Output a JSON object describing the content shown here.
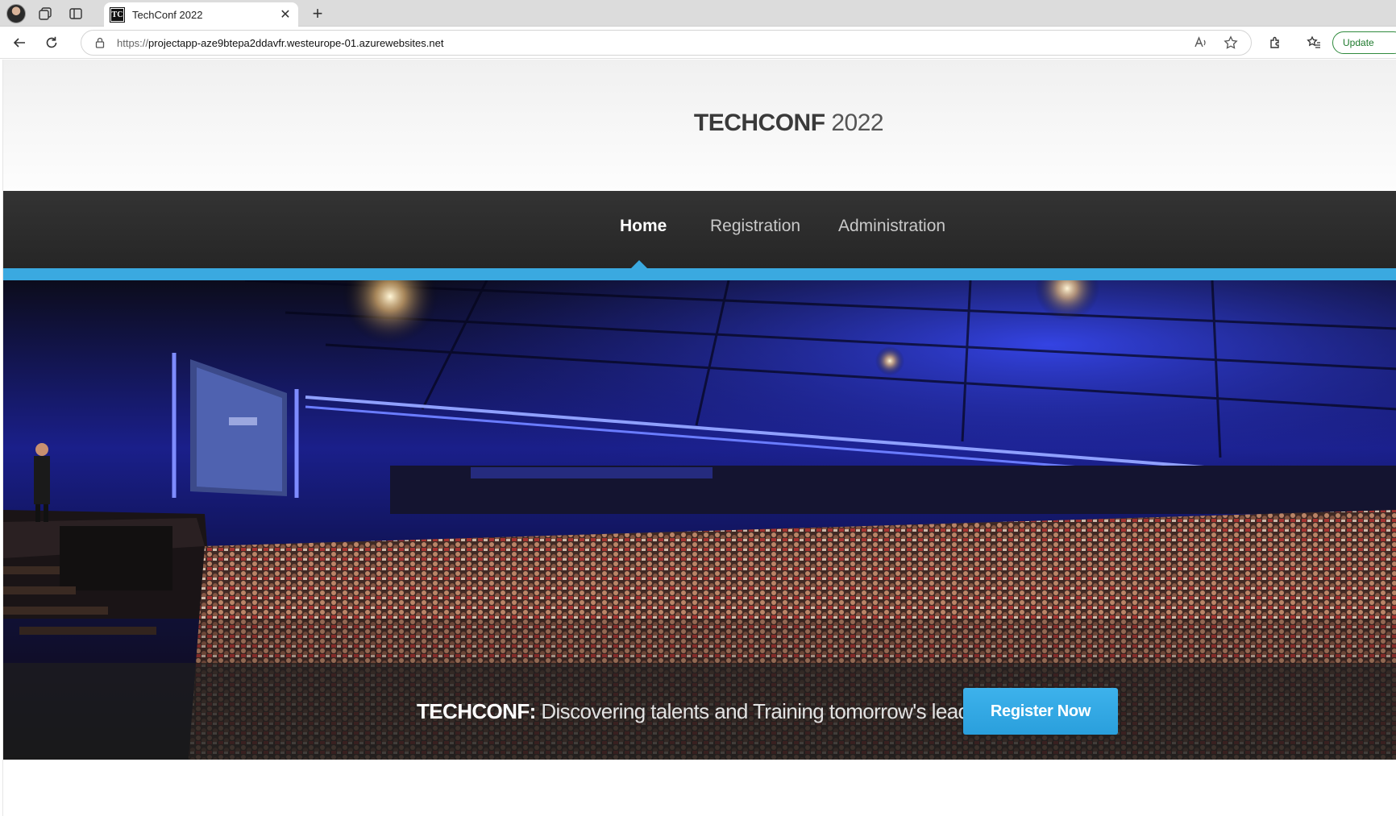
{
  "browser": {
    "tab_title": "TechConf 2022",
    "tab_favicon_text": "TC",
    "url_scheme": "https://",
    "url_host": "projectapp-aze9btepa2ddavfr.westeurope-01.azurewebsites.net",
    "update_label": "Update"
  },
  "site": {
    "brand": "TECHCONF",
    "year": "2022",
    "nav": [
      {
        "label": "Home",
        "active": true
      },
      {
        "label": "Registration",
        "active": false
      },
      {
        "label": "Administration",
        "active": false
      }
    ],
    "hero": {
      "tagline_brand": "TECHCONF:",
      "tagline_text": "Discovering talents and Training tomorrow's leaders",
      "cta_label": "Register Now"
    }
  },
  "colors": {
    "accent": "#3aa9e0",
    "navbar": "#2b2b2b",
    "cta": "#34aae6"
  }
}
